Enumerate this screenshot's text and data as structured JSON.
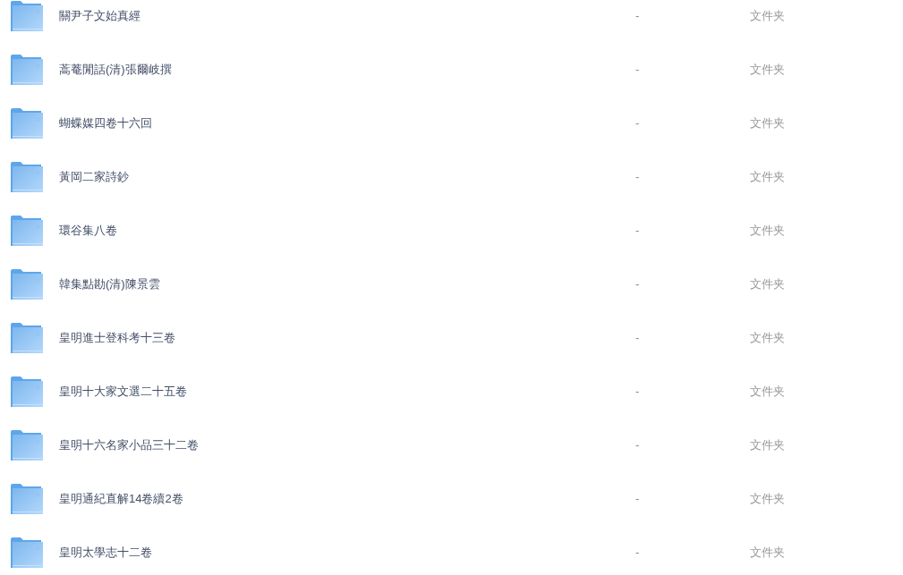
{
  "files": [
    {
      "name": "關尹子文始真經",
      "column_2": "-",
      "column_3": "文件夹"
    },
    {
      "name": "蒿菴閒話(清)張爾岐撰",
      "column_2": "-",
      "column_3": "文件夹"
    },
    {
      "name": "蝴蝶媒四卷十六回",
      "column_2": "-",
      "column_3": "文件夹"
    },
    {
      "name": "黃岡二家詩鈔",
      "column_2": "-",
      "column_3": "文件夹"
    },
    {
      "name": "環谷集八卷",
      "column_2": "-",
      "column_3": "文件夹"
    },
    {
      "name": "韓集點勘(清)陳景雲",
      "column_2": "-",
      "column_3": "文件夹"
    },
    {
      "name": "皇明進士登科考十三卷",
      "column_2": "-",
      "column_3": "文件夹"
    },
    {
      "name": "皇明十大家文選二十五卷",
      "column_2": "-",
      "column_3": "文件夹"
    },
    {
      "name": "皇明十六名家小品三十二卷",
      "column_2": "-",
      "column_3": "文件夹"
    },
    {
      "name": "皇明通紀直解14卷續2卷",
      "column_2": "-",
      "column_3": "文件夹"
    },
    {
      "name": "皇明太學志十二卷",
      "column_2": "-",
      "column_3": "文件夹"
    }
  ]
}
